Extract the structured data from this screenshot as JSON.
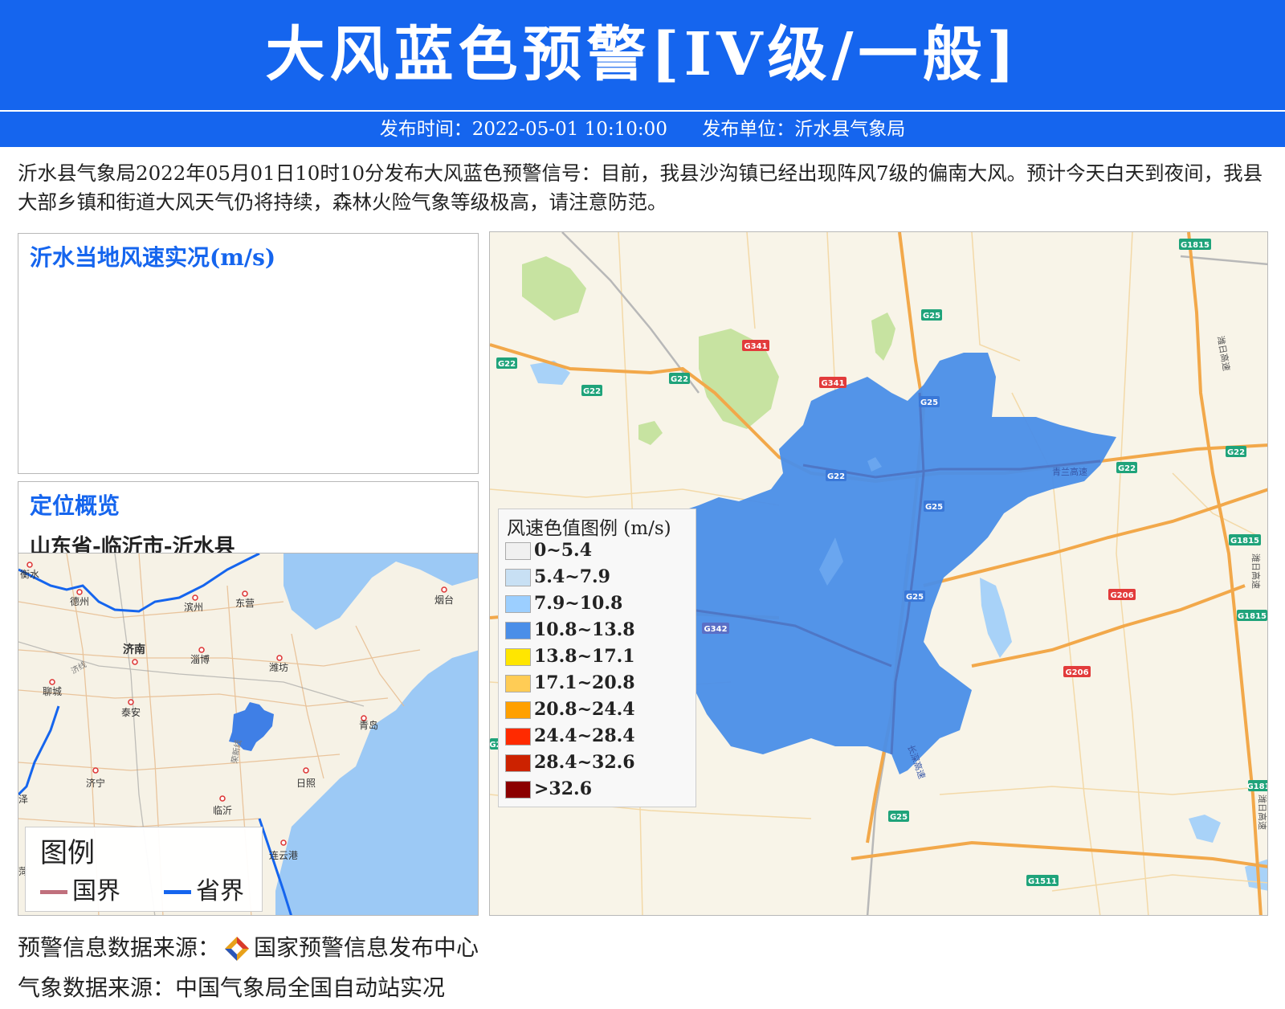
{
  "header": {
    "title": "大风蓝色预警[IV级/一般]",
    "publish_time": "发布时间：2022-05-01 10:10:00",
    "publish_unit": "发布单位：沂水县气象局"
  },
  "description": "沂水县气象局2022年05月01日10时10分发布大风蓝色预警信号：目前，我县沙沟镇已经出现阵风7级的偏南大风。预计今天白天到夜间，我县大部乡镇和街道大风天气仍将持续，森林火险气象等级极高，请注意防范。",
  "wind_panel": {
    "title": "沂水当地风速实况(m/s)"
  },
  "location_panel": {
    "title": "定位概览",
    "path": "山东省-临沂市-沂水县",
    "cities": [
      "衡水",
      "德州",
      "滨州",
      "东营",
      "烟台",
      "济南",
      "淄博",
      "潍坊",
      "聊城",
      "泰安",
      "青岛",
      "济宁",
      "日照",
      "临沂",
      "连云港",
      "泽",
      "菏"
    ],
    "road_labels": [
      "济线",
      "荣新线"
    ],
    "legend": {
      "title": "图例",
      "national": "国界",
      "provincial": "省界",
      "national_color": "#c0707c",
      "provincial_color": "#1565ee"
    }
  },
  "main_map": {
    "highway_labels": [
      "G1815",
      "G25",
      "G341",
      "G22",
      "G22",
      "G22",
      "G341",
      "G25",
      "G22",
      "G22",
      "G22",
      "G25",
      "G1815",
      "G25",
      "G206",
      "G1815",
      "G342",
      "G206",
      "G25",
      "G181",
      "G1511",
      "G2"
    ],
    "road_names": [
      "潍日高速",
      "青兰高速",
      "潍日高速",
      "潍日高速",
      "长深高速"
    ],
    "legend": {
      "title": "风速色值图例 (m/s)",
      "items": [
        {
          "label": "0~5.4",
          "color": "#f0f0f0"
        },
        {
          "label": "5.4~7.9",
          "color": "#c8e0f4"
        },
        {
          "label": "7.9~10.8",
          "color": "#9ccfff"
        },
        {
          "label": "10.8~13.8",
          "color": "#4a8ee8"
        },
        {
          "label": "13.8~17.1",
          "color": "#ffe600"
        },
        {
          "label": "17.1~20.8",
          "color": "#ffcc55"
        },
        {
          "label": "20.8~24.4",
          "color": "#ffa000"
        },
        {
          "label": "24.4~28.4",
          "color": "#ff2a00"
        },
        {
          "label": "28.4~32.6",
          "color": "#cc2200"
        },
        {
          "label": ">32.6",
          "color": "#8b0000"
        }
      ]
    },
    "region_color": "#4a8ee8"
  },
  "footer": {
    "warning_source_label": "预警信息数据来源：",
    "warning_source": "国家预警信息发布中心",
    "weather_source": "气象数据来源：中国气象局全国自动站实况"
  }
}
